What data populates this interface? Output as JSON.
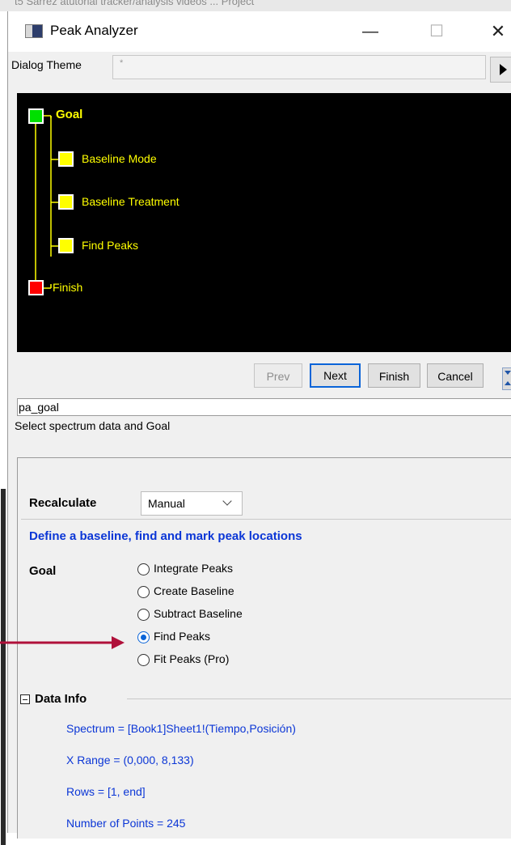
{
  "background_title": "t5 Sarrez atutorial tracker/analysis videos ... Project",
  "window": {
    "title": "Peak Analyzer"
  },
  "theme": {
    "label": "Dialog Theme",
    "value": "*"
  },
  "tree": {
    "nodes": [
      {
        "label": "Goal",
        "color": "#00e000",
        "bold": true
      },
      {
        "label": "Baseline Mode",
        "color": "#ffff00",
        "bold": false
      },
      {
        "label": "Baseline Treatment",
        "color": "#ffff00",
        "bold": false
      },
      {
        "label": "Find Peaks",
        "color": "#ffff00",
        "bold": false
      },
      {
        "label": "Finish",
        "color": "#ff0000",
        "bold": false
      }
    ]
  },
  "nav": {
    "prev": "Prev",
    "next": "Next",
    "finish": "Finish",
    "cancel": "Cancel"
  },
  "page_name": "pa_goal",
  "page_description": "Select spectrum data and Goal",
  "settings": {
    "recalculate_label": "Recalculate",
    "recalculate_value": "Manual",
    "define_text": "Define a baseline, find and mark peak locations",
    "goal_label": "Goal",
    "goal_options": [
      {
        "label": "Integrate Peaks",
        "checked": false
      },
      {
        "label": "Create Baseline",
        "checked": false
      },
      {
        "label": "Subtract Baseline",
        "checked": false
      },
      {
        "label": "Find Peaks",
        "checked": true
      },
      {
        "label": "Fit Peaks (Pro)",
        "checked": false
      }
    ],
    "data_info_title": "Data Info",
    "data_info": [
      "Spectrum = [Book1]Sheet1!(Tiempo,Posición)",
      "X Range = (0,000, 8,133)",
      "Rows = [1, end]",
      "Number of Points = 245"
    ]
  },
  "colors": {
    "accent": "#0b36d6",
    "arrow": "#b0103a",
    "tree_bg": "#000000",
    "tree_text": "#ffff00"
  }
}
